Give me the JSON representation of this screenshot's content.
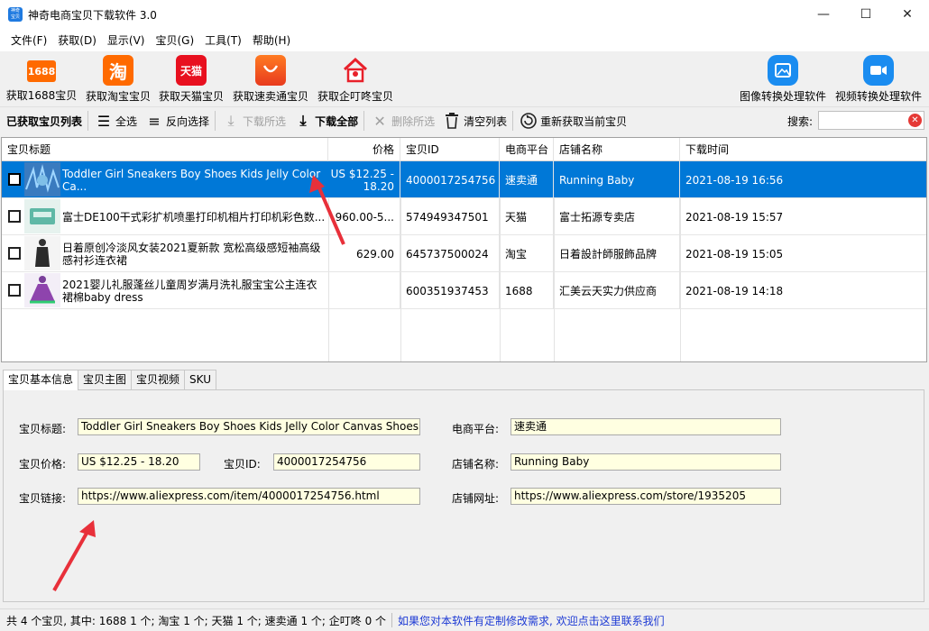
{
  "window": {
    "title": "神奇电商宝贝下载软件 3.0",
    "icon_text": "神奇宝贝"
  },
  "menu": [
    "文件(F)",
    "获取(D)",
    "显示(V)",
    "宝贝(G)",
    "工具(T)",
    "帮助(H)"
  ],
  "big_toolbar": {
    "btn_1688": {
      "label": "获取1688宝贝",
      "icon": "1688"
    },
    "btn_taobao": {
      "label": "获取淘宝宝贝",
      "icon": "淘"
    },
    "btn_tmall": {
      "label": "获取天猫宝贝",
      "icon": "天猫"
    },
    "btn_aliexpress": {
      "label": "获取速卖通宝贝"
    },
    "btn_qidingdong": {
      "label": "获取企叮咚宝贝"
    },
    "btn_image": {
      "label": "图像转换处理软件"
    },
    "btn_video": {
      "label": "视频转换处理软件"
    }
  },
  "small_toolbar": {
    "list_title": "已获取宝贝列表",
    "select_all": "全选",
    "invert": "反向选择",
    "download_selected": "下载所选",
    "download_all": "下载全部",
    "delete_selected": "删除所选",
    "clear_list": "清空列表",
    "refetch": "重新获取当前宝贝",
    "search_label": "搜索:"
  },
  "grid": {
    "columns": [
      "宝贝标题",
      "价格",
      "宝贝ID",
      "电商平台",
      "店铺名称",
      "下载时间"
    ],
    "rows": [
      {
        "title": "Toddler Girl Sneakers Boy Shoes Kids Jelly Color Ca...",
        "price": "US $12.25 - 18.20",
        "id": "4000017254756",
        "platform": "速卖通",
        "shop": "Running Baby",
        "time": "2021-08-19 16:56",
        "selected": true
      },
      {
        "title": "富士DE100干式彩扩机喷墨打印机相片打印机彩色数...",
        "price": "960.00-5...",
        "id": "574949347501",
        "platform": "天猫",
        "shop": "富士拓源专卖店",
        "time": "2021-08-19 15:57",
        "selected": false
      },
      {
        "title": "日着原创冷淡风女装2021夏新款 宽松高级感短袖高级感衬衫连衣裙",
        "price": "629.00",
        "id": "645737500024",
        "platform": "淘宝",
        "shop": "日着設計師服飾品牌",
        "time": "2021-08-19 15:05",
        "selected": false
      },
      {
        "title": "2021婴儿礼服蓬丝儿童周岁满月洗礼服宝宝公主连衣裙棉baby dress",
        "price": "",
        "id": "600351937453",
        "platform": "1688",
        "shop": "汇美云天实力供应商",
        "time": "2021-08-19 14:18",
        "selected": false
      }
    ]
  },
  "tabs": [
    "宝贝基本信息",
    "宝贝主图",
    "宝贝视频",
    "SKU"
  ],
  "detail": {
    "title_label": "宝贝标题:",
    "title_value": "Toddler Girl Sneakers Boy Shoes Kids Jelly Color Canvas Shoes Casual",
    "platform_label": "电商平台:",
    "platform_value": "速卖通",
    "price_label": "宝贝价格:",
    "price_value": "US $12.25 - 18.20",
    "id_label": "宝贝ID:",
    "id_value": "4000017254756",
    "shop_label": "店铺名称:",
    "shop_value": "Running Baby",
    "link_label": "宝贝链接:",
    "link_value": "https://www.aliexpress.com/item/4000017254756.html",
    "shop_url_label": "店铺网址:",
    "shop_url_value": "https://www.aliexpress.com/store/1935205"
  },
  "status": {
    "summary": "共 4 个宝贝, 其中: 1688 1 个; 淘宝 1 个; 天猫 1 个; 速卖通 1 个; 企叮咚 0 个",
    "link": "如果您对本软件有定制修改需求, 欢迎点击这里联系我们"
  },
  "colors": {
    "selection": "#0078d7",
    "field_bg": "#ffffe1",
    "link": "#1c39d4",
    "arrow": "#e8303a"
  }
}
